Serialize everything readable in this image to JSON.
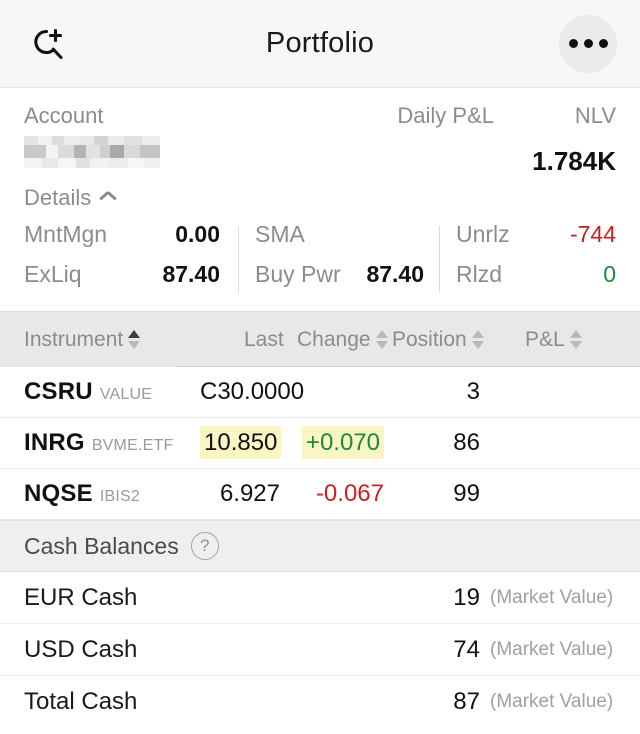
{
  "header": {
    "title": "Portfolio",
    "search_add_icon": "search-plus-icon",
    "more_icon": "more-horizontal-icon"
  },
  "account": {
    "label": "Account",
    "id_masked": "",
    "details_label": "Details",
    "details_chevron": "chevron-up-icon",
    "daily_pl_label": "Daily P&L",
    "daily_pl_value": "",
    "nlv_label": "NLV",
    "nlv_value": "1.784K",
    "details": [
      {
        "key": "MntMgn",
        "value": "0.00",
        "tone": "plain"
      },
      {
        "key": "ExLiq",
        "value": "87.40",
        "tone": "plain"
      },
      {
        "key": "SMA",
        "value": "",
        "tone": "blank"
      },
      {
        "key": "Buy Pwr",
        "value": "87.40",
        "tone": "plain"
      },
      {
        "key": "Unrlz",
        "value": "-744",
        "tone": "neg"
      },
      {
        "key": "Rlzd",
        "value": "0",
        "tone": "pos"
      }
    ]
  },
  "table": {
    "columns": {
      "instrument": "Instrument",
      "last": "Last",
      "change": "Change",
      "position": "Position",
      "pl": "P&L"
    },
    "sort": {
      "column": "Instrument",
      "direction": "asc"
    },
    "rows": [
      {
        "symbol": "CSRU",
        "exchange": "VALUE",
        "last": "C30.0000",
        "last_highlight": false,
        "change": "",
        "change_highlight": false,
        "change_tone": "plain",
        "position": "3",
        "pl": ""
      },
      {
        "symbol": "INRG",
        "exchange": "BVME.ETF",
        "last": "10.850",
        "last_highlight": true,
        "change": "+0.070",
        "change_highlight": true,
        "change_tone": "up",
        "position": "86",
        "pl": ""
      },
      {
        "symbol": "NQSE",
        "exchange": "IBIS2",
        "last": "6.927",
        "last_highlight": false,
        "change": "-0.067",
        "change_highlight": false,
        "change_tone": "down",
        "position": "99",
        "pl": ""
      }
    ]
  },
  "cash": {
    "title": "Cash Balances",
    "help_icon": "question-mark-circle-icon",
    "rows": [
      {
        "name": "EUR Cash",
        "value": "19",
        "note": "(Market Value)"
      },
      {
        "name": "USD Cash",
        "value": "74",
        "note": "(Market Value)"
      },
      {
        "name": "Total Cash",
        "value": "87",
        "note": "(Market Value)"
      }
    ]
  },
  "colors": {
    "positive": "#1a8a3c",
    "negative": "#cc2020",
    "highlight": "#faf6c4",
    "header_bg": "#f7f7f7",
    "table_header_bg": "#e8e8e8"
  }
}
